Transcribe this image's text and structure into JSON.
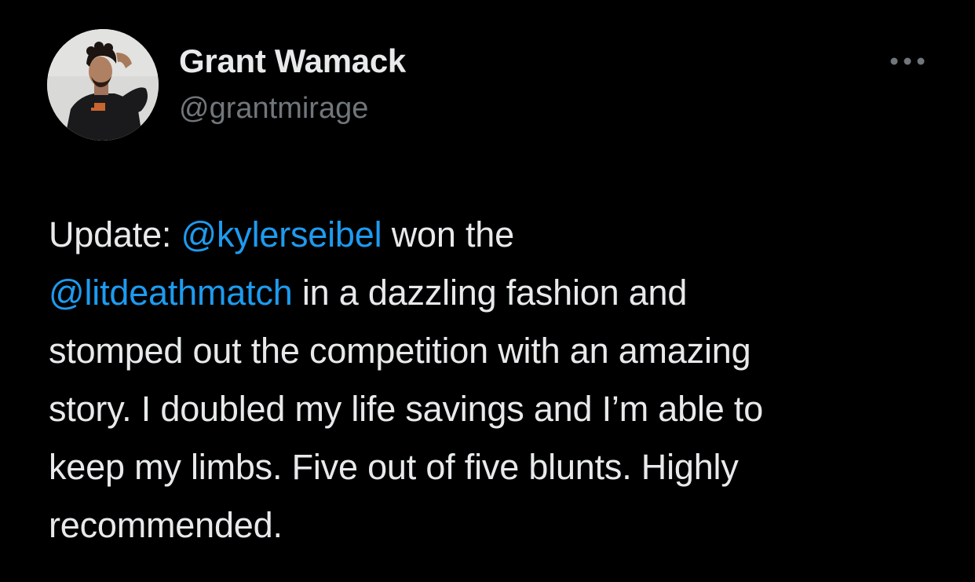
{
  "author": {
    "display_name": "Grant Wamack",
    "handle": "@grantmirage"
  },
  "more_icon": "ellipsis-icon",
  "tweet": {
    "t1": "Update: ",
    "mention1": "@kylerseibel",
    "t2": " won the",
    "mention2": "@litdeathmatch",
    "t3": " in a dazzling fashion and",
    "t4": "stomped out the competition with an amazing",
    "t5": "story. I doubled my life savings and I’m able to",
    "t6": "keep my limbs. Five out of five blunts. Highly",
    "t7": "recommended."
  },
  "colors": {
    "background": "#000000",
    "text": "#e7e9ea",
    "secondary": "#71767b",
    "link": "#1d9bf0"
  }
}
